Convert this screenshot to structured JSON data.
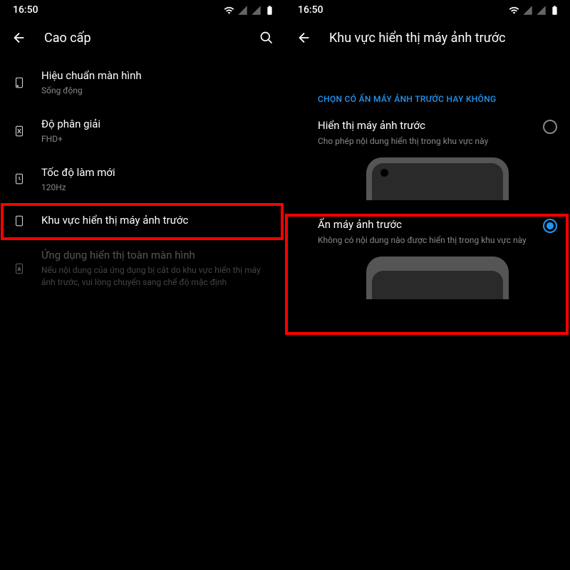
{
  "status": {
    "time": "16:50"
  },
  "left": {
    "title": "Cao cấp",
    "items": [
      {
        "title": "Hiệu chuẩn màn hình",
        "sub": "Sống động"
      },
      {
        "title": "Độ phân giải",
        "sub": "FHD+"
      },
      {
        "title": "Tốc độ làm mới",
        "sub": "120Hz"
      },
      {
        "title": "Khu vực hiển thị máy ảnh trước",
        "sub": ""
      },
      {
        "title": "Ứng dụng hiển thị toàn màn hình",
        "sub": "Nếu nội dung của ứng dụng bị cắt do khu vực hiển thị máy ảnh trước, vui lòng chuyển sang chế độ mặc định"
      }
    ]
  },
  "right": {
    "title": "Khu vực hiển thị máy ảnh trước",
    "section": "CHỌN CÓ ẨN MÁY ẢNH TRƯỚC HAY KHÔNG",
    "options": [
      {
        "title": "Hiển thị máy ảnh trước",
        "sub": "Cho phép nội dung hiển thị trong khu vực này",
        "selected": false
      },
      {
        "title": "Ẩn máy ảnh trước",
        "sub": "Không có nội dung nào được hiển thị trong khu vực này",
        "selected": true
      }
    ]
  }
}
